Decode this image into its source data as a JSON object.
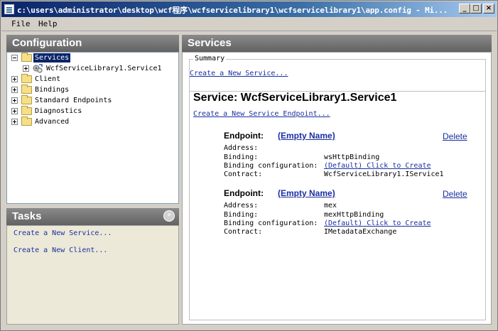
{
  "window": {
    "title": "c:\\users\\administrator\\desktop\\wcf程序\\wcfservicelibrary1\\wcfservicelibrary1\\app.config - Mi...",
    "minimize": "_",
    "maximize": "□",
    "close": "×"
  },
  "menu": {
    "file": "File",
    "help": "Help"
  },
  "configuration": {
    "header": "Configuration",
    "tree": {
      "services": "Services",
      "service1": "WcfServiceLibrary1.Service1",
      "client": "Client",
      "bindings": "Bindings",
      "standard_endpoints": "Standard Endpoints",
      "diagnostics": "Diagnostics",
      "advanced": "Advanced"
    }
  },
  "tasks": {
    "header": "Tasks",
    "chevron": "»",
    "create_service": "Create a New Service...",
    "create_client": "Create a New Client..."
  },
  "services_panel": {
    "header": "Services",
    "summary_label": "Summary",
    "create_service_link": "Create a New Service...",
    "service_title": "Service: WcfServiceLibrary1.Service1",
    "create_endpoint_link": "Create a New Service Endpoint...",
    "endpoints": [
      {
        "label": "Endpoint:",
        "name": "(Empty Name)",
        "delete": "Delete",
        "address_label": "Address:",
        "address": "",
        "binding_label": "Binding:",
        "binding": "wsHttpBinding",
        "binding_config_label": "Binding configuration:",
        "binding_config": "(Default) Click to Create",
        "contract_label": "Contract:",
        "contract": "WcfServiceLibrary1.IService1"
      },
      {
        "label": "Endpoint:",
        "name": "(Empty Name)",
        "delete": "Delete",
        "address_label": "Address:",
        "address": "mex",
        "binding_label": "Binding:",
        "binding": "mexHttpBinding",
        "binding_config_label": "Binding configuration:",
        "binding_config": "(Default) Click to Create",
        "contract_label": "Contract:",
        "contract": "IMetadataExchange"
      }
    ]
  }
}
